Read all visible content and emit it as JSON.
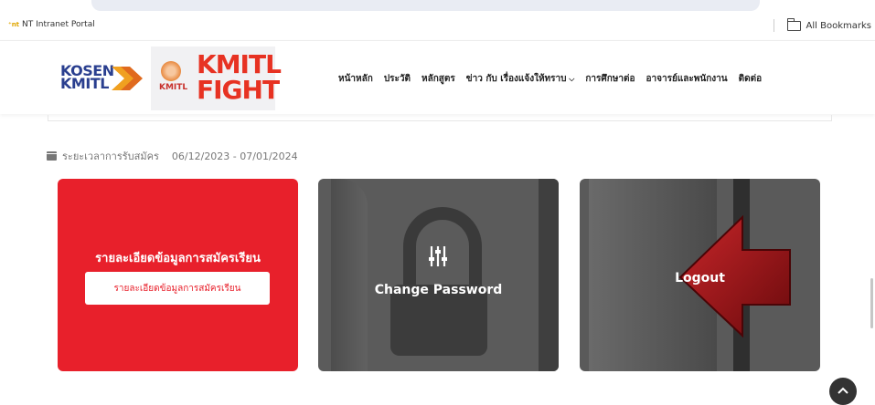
{
  "browser": {
    "bookmark_left": "NT Intranet Portal",
    "bookmark_left_icon": "nt-favicon",
    "bookmark_right": "All Bookmarks",
    "bookmark_right_icon": "folder-icon"
  },
  "header": {
    "logo_kosen_line1": "KOSEN",
    "logo_kosen_line2": "KMITL",
    "logo_kmitl_text": "KMITL",
    "logo_fight_top": "KMITL",
    "logo_fight_bottom": "FIGHT",
    "nav": [
      "หน้าหลัก",
      "ประวัติ",
      "หลักสูตร",
      "ข่าว กับ เรื่องแจ้งให้ทราบ",
      "การศึกษาต่อ",
      "อาจารย์และพนักงาน",
      "ติดต่อ"
    ]
  },
  "period": {
    "label": "ระยะเวลาการรับสมัคร",
    "value": "06/12/2023 - 07/01/2024",
    "icon": "calendar-icon"
  },
  "cards": {
    "details_title": "รายละเอียดข้อมูลการสมัครเรียน",
    "details_button": "รายละเอียดข้อมูลการสมัครเรียน",
    "change_password": "Change Password",
    "logout": "Logout"
  },
  "colors": {
    "accent_red": "#e8202b",
    "card_dark": "#5b5b5b",
    "arrow_red": "#8a0e10"
  }
}
